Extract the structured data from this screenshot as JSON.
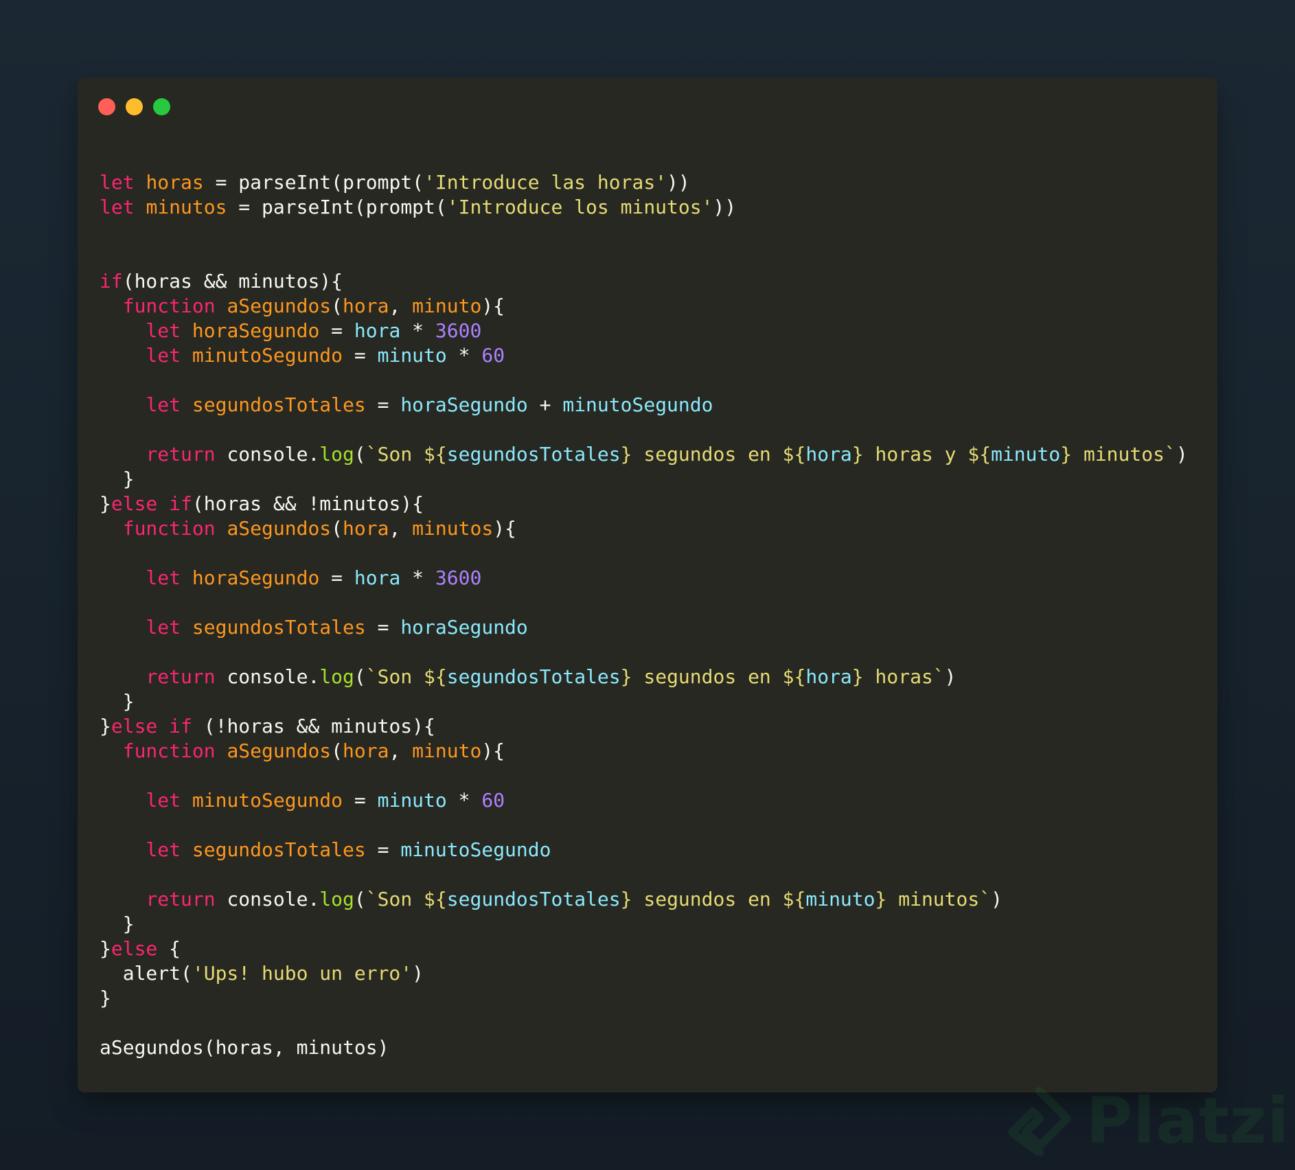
{
  "window": {
    "controls": [
      {
        "name": "close",
        "color": "#ff5f56"
      },
      {
        "name": "minimize",
        "color": "#ffbd2e"
      },
      {
        "name": "maximize",
        "color": "#27c93f"
      }
    ]
  },
  "code_lines": [
    [
      [
        "kw",
        "let"
      ],
      [
        "pl",
        " "
      ],
      [
        "id",
        "horas"
      ],
      [
        "pl",
        " = parseInt(prompt("
      ],
      [
        "str",
        "'Introduce las horas'"
      ],
      [
        "pl",
        "))"
      ]
    ],
    [
      [
        "kw",
        "let"
      ],
      [
        "pl",
        " "
      ],
      [
        "id",
        "minutos"
      ],
      [
        "pl",
        " = parseInt(prompt("
      ],
      [
        "str",
        "'Introduce los minutos'"
      ],
      [
        "pl",
        "))"
      ]
    ],
    [],
    [],
    [
      [
        "kw",
        "if"
      ],
      [
        "pl",
        "(horas && minutos){"
      ]
    ],
    [
      [
        "pl",
        "  "
      ],
      [
        "kw",
        "function"
      ],
      [
        "pl",
        " "
      ],
      [
        "id",
        "aSegundos"
      ],
      [
        "pl",
        "("
      ],
      [
        "id",
        "hora"
      ],
      [
        "pl",
        ", "
      ],
      [
        "id",
        "minuto"
      ],
      [
        "pl",
        "){"
      ]
    ],
    [
      [
        "pl",
        "    "
      ],
      [
        "kw",
        "let"
      ],
      [
        "pl",
        " "
      ],
      [
        "id",
        "horaSegundo"
      ],
      [
        "pl",
        " = "
      ],
      [
        "var",
        "hora"
      ],
      [
        "pl",
        " * "
      ],
      [
        "num",
        "3600"
      ]
    ],
    [
      [
        "pl",
        "    "
      ],
      [
        "kw",
        "let"
      ],
      [
        "pl",
        " "
      ],
      [
        "id",
        "minutoSegundo"
      ],
      [
        "pl",
        " = "
      ],
      [
        "var",
        "minuto"
      ],
      [
        "pl",
        " * "
      ],
      [
        "num",
        "60"
      ]
    ],
    [],
    [
      [
        "pl",
        "    "
      ],
      [
        "kw",
        "let"
      ],
      [
        "pl",
        " "
      ],
      [
        "id",
        "segundosTotales"
      ],
      [
        "pl",
        " = "
      ],
      [
        "var",
        "horaSegundo"
      ],
      [
        "pl",
        " + "
      ],
      [
        "var",
        "minutoSegundo"
      ]
    ],
    [],
    [
      [
        "pl",
        "    "
      ],
      [
        "kw",
        "return"
      ],
      [
        "pl",
        " console."
      ],
      [
        "fn",
        "log"
      ],
      [
        "pl",
        "("
      ],
      [
        "str",
        "`Son ${"
      ],
      [
        "var",
        "segundosTotales"
      ],
      [
        "str",
        "} segundos en ${"
      ],
      [
        "var",
        "hora"
      ],
      [
        "str",
        "} horas y ${"
      ],
      [
        "var",
        "minuto"
      ],
      [
        "str",
        "} minutos`"
      ],
      [
        "pl",
        ")"
      ]
    ],
    [
      [
        "pl",
        "  }"
      ]
    ],
    [
      [
        "pl",
        "}"
      ],
      [
        "kw",
        "else if"
      ],
      [
        "pl",
        "(horas && !minutos){"
      ]
    ],
    [
      [
        "pl",
        "  "
      ],
      [
        "kw",
        "function"
      ],
      [
        "pl",
        " "
      ],
      [
        "id",
        "aSegundos"
      ],
      [
        "pl",
        "("
      ],
      [
        "id",
        "hora"
      ],
      [
        "pl",
        ", "
      ],
      [
        "id",
        "minutos"
      ],
      [
        "pl",
        "){"
      ]
    ],
    [],
    [
      [
        "pl",
        "    "
      ],
      [
        "kw",
        "let"
      ],
      [
        "pl",
        " "
      ],
      [
        "id",
        "horaSegundo"
      ],
      [
        "pl",
        " = "
      ],
      [
        "var",
        "hora"
      ],
      [
        "pl",
        " * "
      ],
      [
        "num",
        "3600"
      ]
    ],
    [],
    [
      [
        "pl",
        "    "
      ],
      [
        "kw",
        "let"
      ],
      [
        "pl",
        " "
      ],
      [
        "id",
        "segundosTotales"
      ],
      [
        "pl",
        " = "
      ],
      [
        "var",
        "horaSegundo"
      ]
    ],
    [],
    [
      [
        "pl",
        "    "
      ],
      [
        "kw",
        "return"
      ],
      [
        "pl",
        " console."
      ],
      [
        "fn",
        "log"
      ],
      [
        "pl",
        "("
      ],
      [
        "str",
        "`Son ${"
      ],
      [
        "var",
        "segundosTotales"
      ],
      [
        "str",
        "} segundos en ${"
      ],
      [
        "var",
        "hora"
      ],
      [
        "str",
        "} horas`"
      ],
      [
        "pl",
        ")"
      ]
    ],
    [
      [
        "pl",
        "  }"
      ]
    ],
    [
      [
        "pl",
        "}"
      ],
      [
        "kw",
        "else if"
      ],
      [
        "pl",
        " (!horas && minutos){"
      ]
    ],
    [
      [
        "pl",
        "  "
      ],
      [
        "kw",
        "function"
      ],
      [
        "pl",
        " "
      ],
      [
        "id",
        "aSegundos"
      ],
      [
        "pl",
        "("
      ],
      [
        "id",
        "hora"
      ],
      [
        "pl",
        ", "
      ],
      [
        "id",
        "minuto"
      ],
      [
        "pl",
        "){"
      ]
    ],
    [],
    [
      [
        "pl",
        "    "
      ],
      [
        "kw",
        "let"
      ],
      [
        "pl",
        " "
      ],
      [
        "id",
        "minutoSegundo"
      ],
      [
        "pl",
        " = "
      ],
      [
        "var",
        "minuto"
      ],
      [
        "pl",
        " * "
      ],
      [
        "num",
        "60"
      ]
    ],
    [],
    [
      [
        "pl",
        "    "
      ],
      [
        "kw",
        "let"
      ],
      [
        "pl",
        " "
      ],
      [
        "id",
        "segundosTotales"
      ],
      [
        "pl",
        " = "
      ],
      [
        "var",
        "minutoSegundo"
      ]
    ],
    [],
    [
      [
        "pl",
        "    "
      ],
      [
        "kw",
        "return"
      ],
      [
        "pl",
        " console."
      ],
      [
        "fn",
        "log"
      ],
      [
        "pl",
        "("
      ],
      [
        "str",
        "`Son ${"
      ],
      [
        "var",
        "segundosTotales"
      ],
      [
        "str",
        "} segundos en ${"
      ],
      [
        "var",
        "minuto"
      ],
      [
        "str",
        "} minutos`"
      ],
      [
        "pl",
        ")"
      ]
    ],
    [
      [
        "pl",
        "  }"
      ]
    ],
    [
      [
        "pl",
        "}"
      ],
      [
        "kw",
        "else"
      ],
      [
        "pl",
        " {"
      ]
    ],
    [
      [
        "pl",
        "  alert("
      ],
      [
        "str",
        "'Ups! hubo un erro'"
      ],
      [
        "pl",
        ")"
      ]
    ],
    [
      [
        "pl",
        "}"
      ]
    ],
    [],
    [
      [
        "pl",
        "aSegundos(horas, minutos)"
      ]
    ]
  ],
  "syntax_colors": {
    "keyword": "#f92672",
    "identifier": "#fd971f",
    "string": "#e6db74",
    "variable": "#8be9fd",
    "number": "#ae81ff",
    "function_call": "#a6e22e",
    "plain": "#f8f8f2",
    "editor_background": "#272822"
  },
  "watermark": {
    "text": "Platzi",
    "icon": "platzi-logo-icon"
  }
}
